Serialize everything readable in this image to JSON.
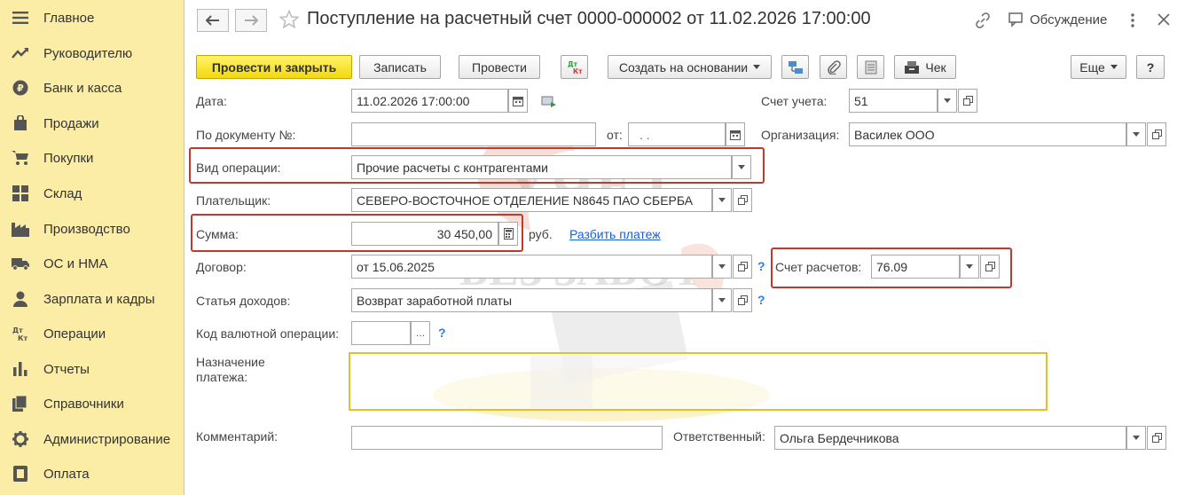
{
  "sidebar": {
    "items": [
      {
        "label": "Главное",
        "icon": "menu-icon"
      },
      {
        "label": "Руководителю",
        "icon": "trend-icon"
      },
      {
        "label": "Банк и касса",
        "icon": "coin-icon"
      },
      {
        "label": "Продажи",
        "icon": "bag-icon"
      },
      {
        "label": "Покупки",
        "icon": "cart-icon"
      },
      {
        "label": "Склад",
        "icon": "warehouse-icon"
      },
      {
        "label": "Производство",
        "icon": "factory-icon"
      },
      {
        "label": "ОС и НМА",
        "icon": "truck-icon"
      },
      {
        "label": "Зарплата и кадры",
        "icon": "person-icon"
      },
      {
        "label": "Операции",
        "icon": "dt-kt-icon"
      },
      {
        "label": "Отчеты",
        "icon": "bar-chart-icon"
      },
      {
        "label": "Справочники",
        "icon": "books-icon"
      },
      {
        "label": "Администрирование",
        "icon": "gear-icon"
      },
      {
        "label": "Оплата",
        "icon": "payment-icon"
      }
    ]
  },
  "header": {
    "title": "Поступление на расчетный счет 0000-000002 от 11.02.2026 17:00:00",
    "discussion_label": "Обсуждение"
  },
  "toolbar": {
    "post_close_label": "Провести и закрыть",
    "save_label": "Записать",
    "post_label": "Провести",
    "dtkt_label": "Дт Кт",
    "create_based_label": "Создать на основании",
    "check_label": "Чек",
    "more_label": "Еще",
    "help_label": "?"
  },
  "form": {
    "date_label": "Дата:",
    "date_value": "11.02.2026 17:00:00",
    "doc_num_label": "По документу №:",
    "doc_num_value": "",
    "from_label": "от:",
    "from_value": ". .",
    "account_label": "Счет учета:",
    "account_value": "51",
    "org_label": "Организация:",
    "org_value": "Василек ООО",
    "op_type_label": "Вид операции:",
    "op_type_value": "Прочие расчеты с контрагентами",
    "payer_label": "Плательщик:",
    "payer_value": "СЕВЕРО-ВОСТОЧНОЕ ОТДЕЛЕНИЕ N8645 ПАО СБЕРБА",
    "sum_label": "Сумма:",
    "sum_value": "30 450,00",
    "currency_label": "руб.",
    "split_link": "Разбить платеж",
    "contract_label": "Договор:",
    "contract_value": "от 15.06.2025",
    "settle_account_label": "Счет расчетов:",
    "settle_account_value": "76.09",
    "income_item_label": "Статья доходов:",
    "income_item_value": "Возврат заработной платы",
    "currency_op_label": "Код валютной операции:",
    "currency_op_value": "",
    "purpose_label": "Назначение платежа:",
    "purpose_value": "",
    "comment_label": "Комментарий:",
    "comment_value": "",
    "responsible_label": "Ответственный:",
    "responsible_value": "Ольга Бердечникова"
  },
  "watermark": {
    "line1": "УЧЕТ",
    "line2": "БЕЗ ЗАБОТ"
  },
  "colors": {
    "sidebar_bg": "#fbeca6",
    "primary_button": "#f4d80e",
    "highlight_frame": "#c0392b",
    "purpose_border": "#e2c22a",
    "link": "#1b5ecf"
  }
}
